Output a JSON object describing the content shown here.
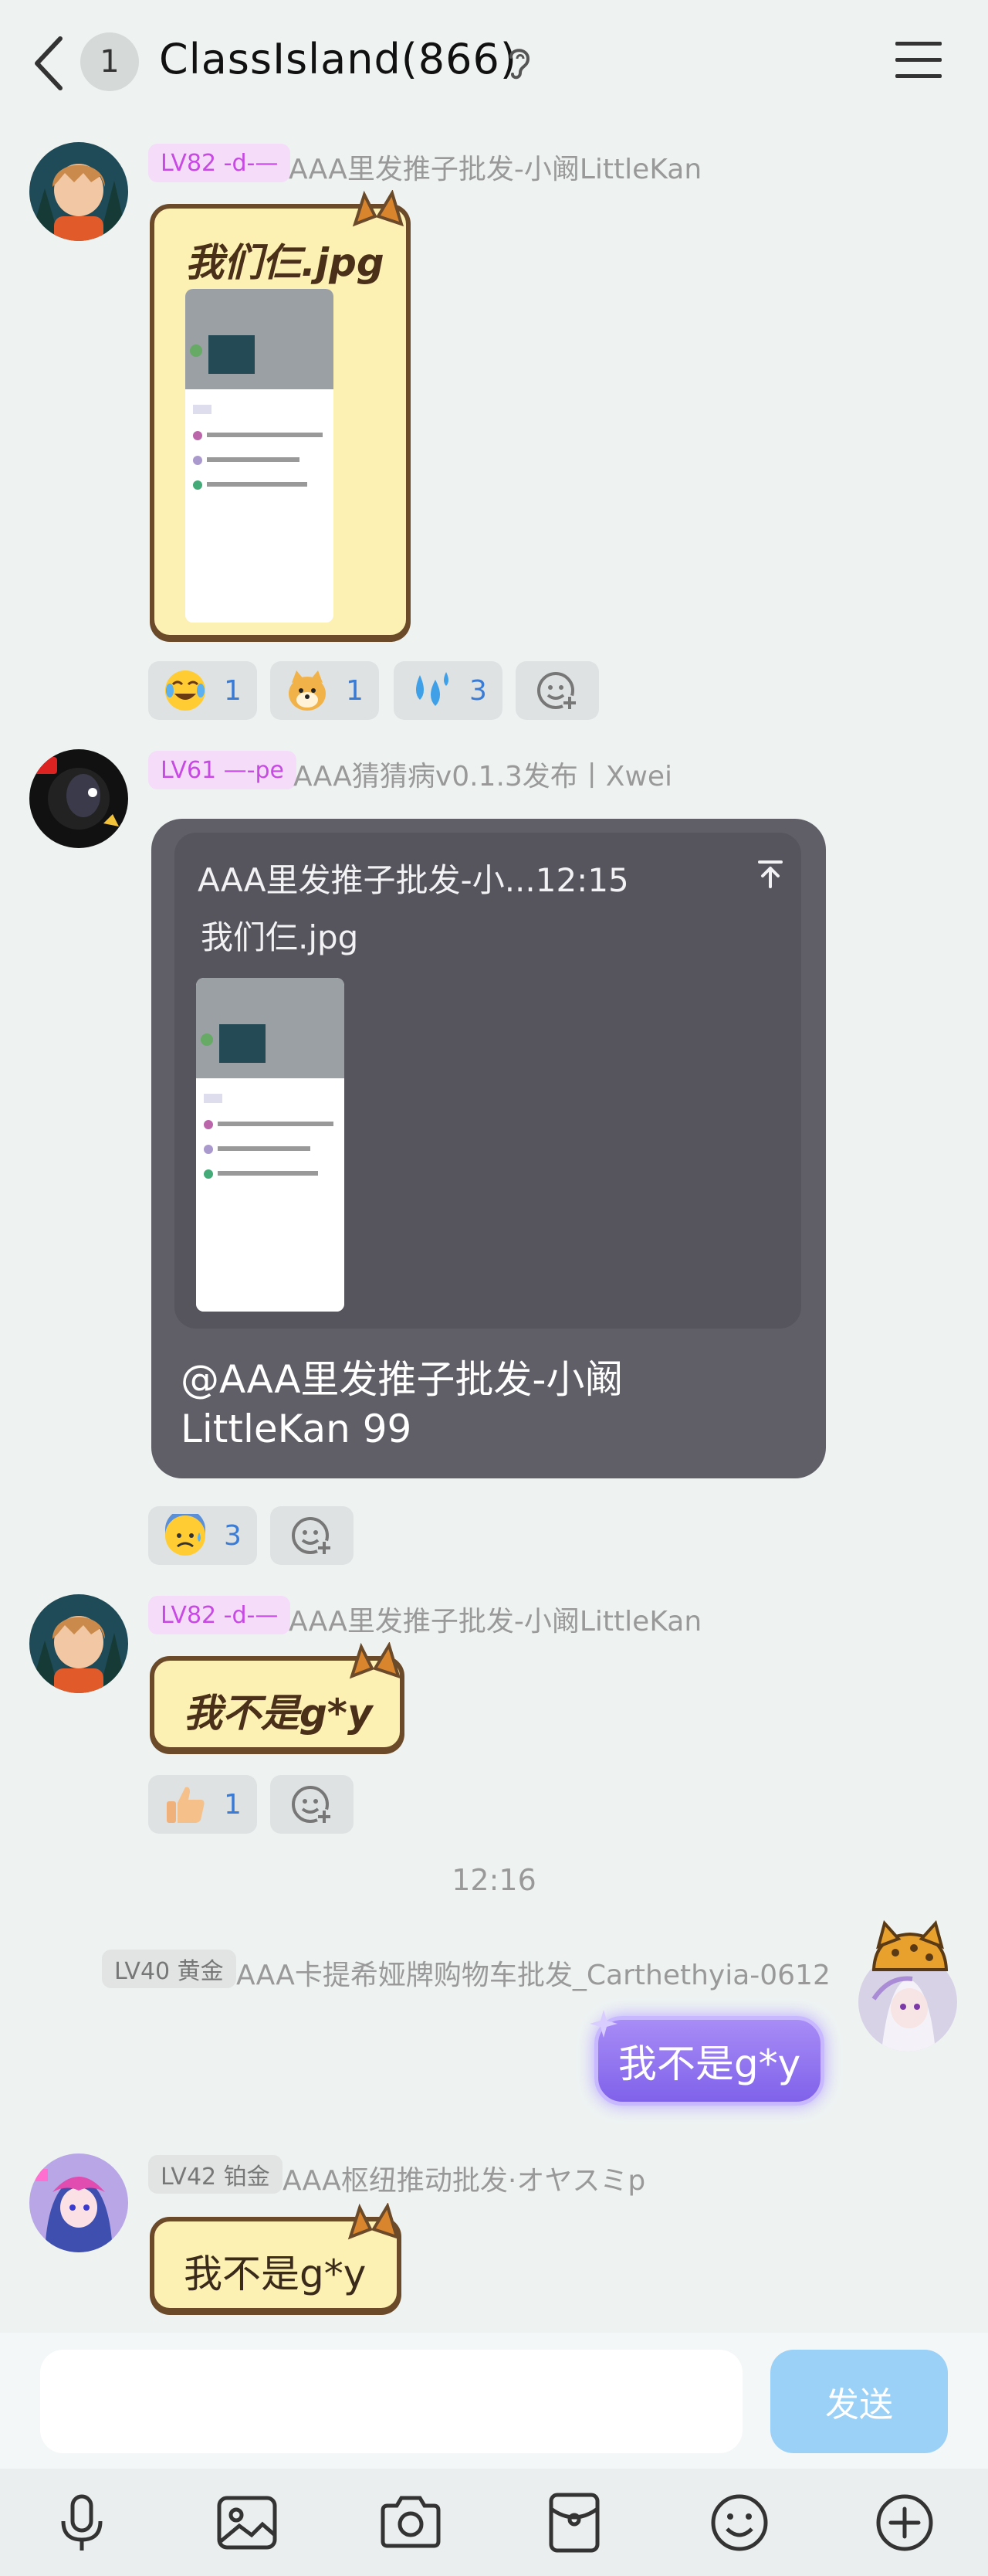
{
  "header": {
    "unread_count": "1",
    "title": "ClassIsland(866)"
  },
  "messages": [
    {
      "level": "LV82 -d-—",
      "name": "AAA里发推子批发-小阚LittleKan",
      "image_caption": "我们仨.jpg",
      "reactions": [
        {
          "emoji": "joy-emoji",
          "count": "1"
        },
        {
          "emoji": "doge-emoji",
          "count": "1"
        },
        {
          "emoji": "sweat-drops-emoji",
          "count": "3"
        }
      ]
    },
    {
      "level": "LV61 —-pe",
      "name": "AAA猜猜病v0.1.3发布丨Xwei",
      "quote_header": "AAA里发推子批发-小...12:15",
      "quote_text": "我们仨.jpg",
      "text": "@AAA里发推子批发-小阚LittleKan 99",
      "reactions": [
        {
          "emoji": "anxious-sweat-emoji",
          "count": "3"
        }
      ]
    },
    {
      "level": "LV82 -d-—",
      "name": "AAA里发推子批发-小阚LittleKan",
      "text": "我不是g*y",
      "reactions": [
        {
          "emoji": "thumbs-up-emoji",
          "count": "1"
        }
      ]
    },
    {
      "level": "LV40 黄金",
      "name": "AAA卡提希娅牌购物车批发_Carthethyia-0612",
      "text": "我不是g*y"
    },
    {
      "level": "LV42 铂金",
      "name": "AAA枢纽推动批发·オヤスミp",
      "text": "我不是g*y"
    }
  ],
  "time_divider": "12:16",
  "input": {
    "placeholder": "",
    "send_label": "发送"
  },
  "toolbar": [
    "microphone-icon",
    "image-icon",
    "camera-icon",
    "red-packet-icon",
    "emoji-icon",
    "plus-icon"
  ],
  "colors": {
    "background": "#eef3f2",
    "level_badge_pink": "#c74ae3",
    "reaction_count": "#3a7bd5",
    "send_button": "#9bd0f7",
    "reply_bubble": "#605e67",
    "cat_bubble": "#fdf0b3"
  }
}
